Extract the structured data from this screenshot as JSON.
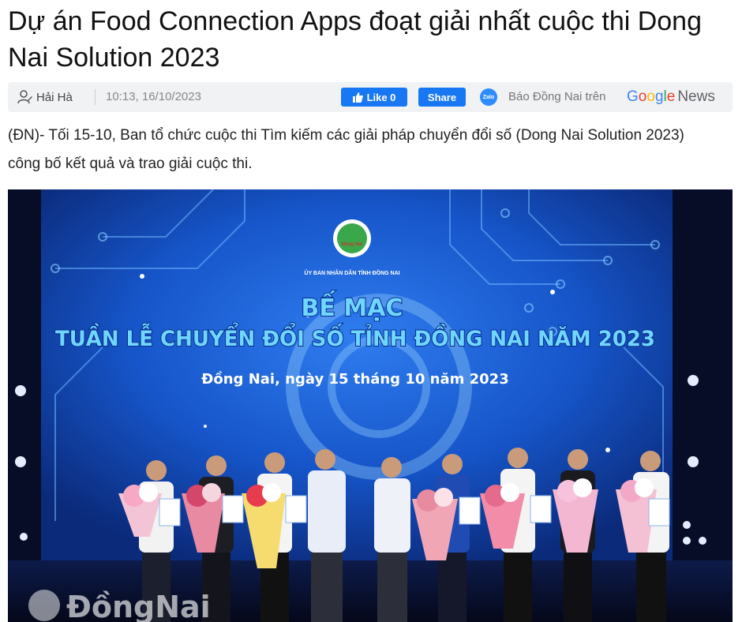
{
  "article": {
    "title": "Dự án Food Connection Apps đoạt giải nhất cuộc thi Dong Nai Solution 2023",
    "author": "Hải Hà",
    "timestamp": "10:13, 16/10/2023",
    "lead": "(ĐN)- Tối 15-10, Ban tổ chức cuộc thi Tìm kiếm các giải pháp chuyển đổi số (Dong Nai Solution 2023) công bố kết quả và trao giải cuộc thi."
  },
  "share": {
    "like_label": "Like 0",
    "share_label": "Share",
    "zalo_label": "Zalo",
    "gnews_prefix": "Báo Đồng Nai trên",
    "gnews_brand": [
      "G",
      "o",
      "o",
      "g",
      "l",
      "e"
    ],
    "gnews_suffix": "News"
  },
  "photo": {
    "org_text": "ỦY BAN NHÂN DÂN TỈNH ĐỒNG NAI",
    "logo_text": "Đồng Nai",
    "headline_1": "BẾ MẠC",
    "headline_2": "TUẦN LỄ CHUYỂN ĐỔI SỐ TỈNH ĐỒNG NAI NĂM 2023",
    "dateline": "Đồng Nai, ngày 15 tháng 10 năm 2023",
    "watermark": "ĐồngNai"
  },
  "colors": {
    "facebook_blue": "#1877f2",
    "zalo_blue": "#2d8cff",
    "stage_blue": "#1655c9",
    "headline_cyan": "#6fd6ff"
  }
}
